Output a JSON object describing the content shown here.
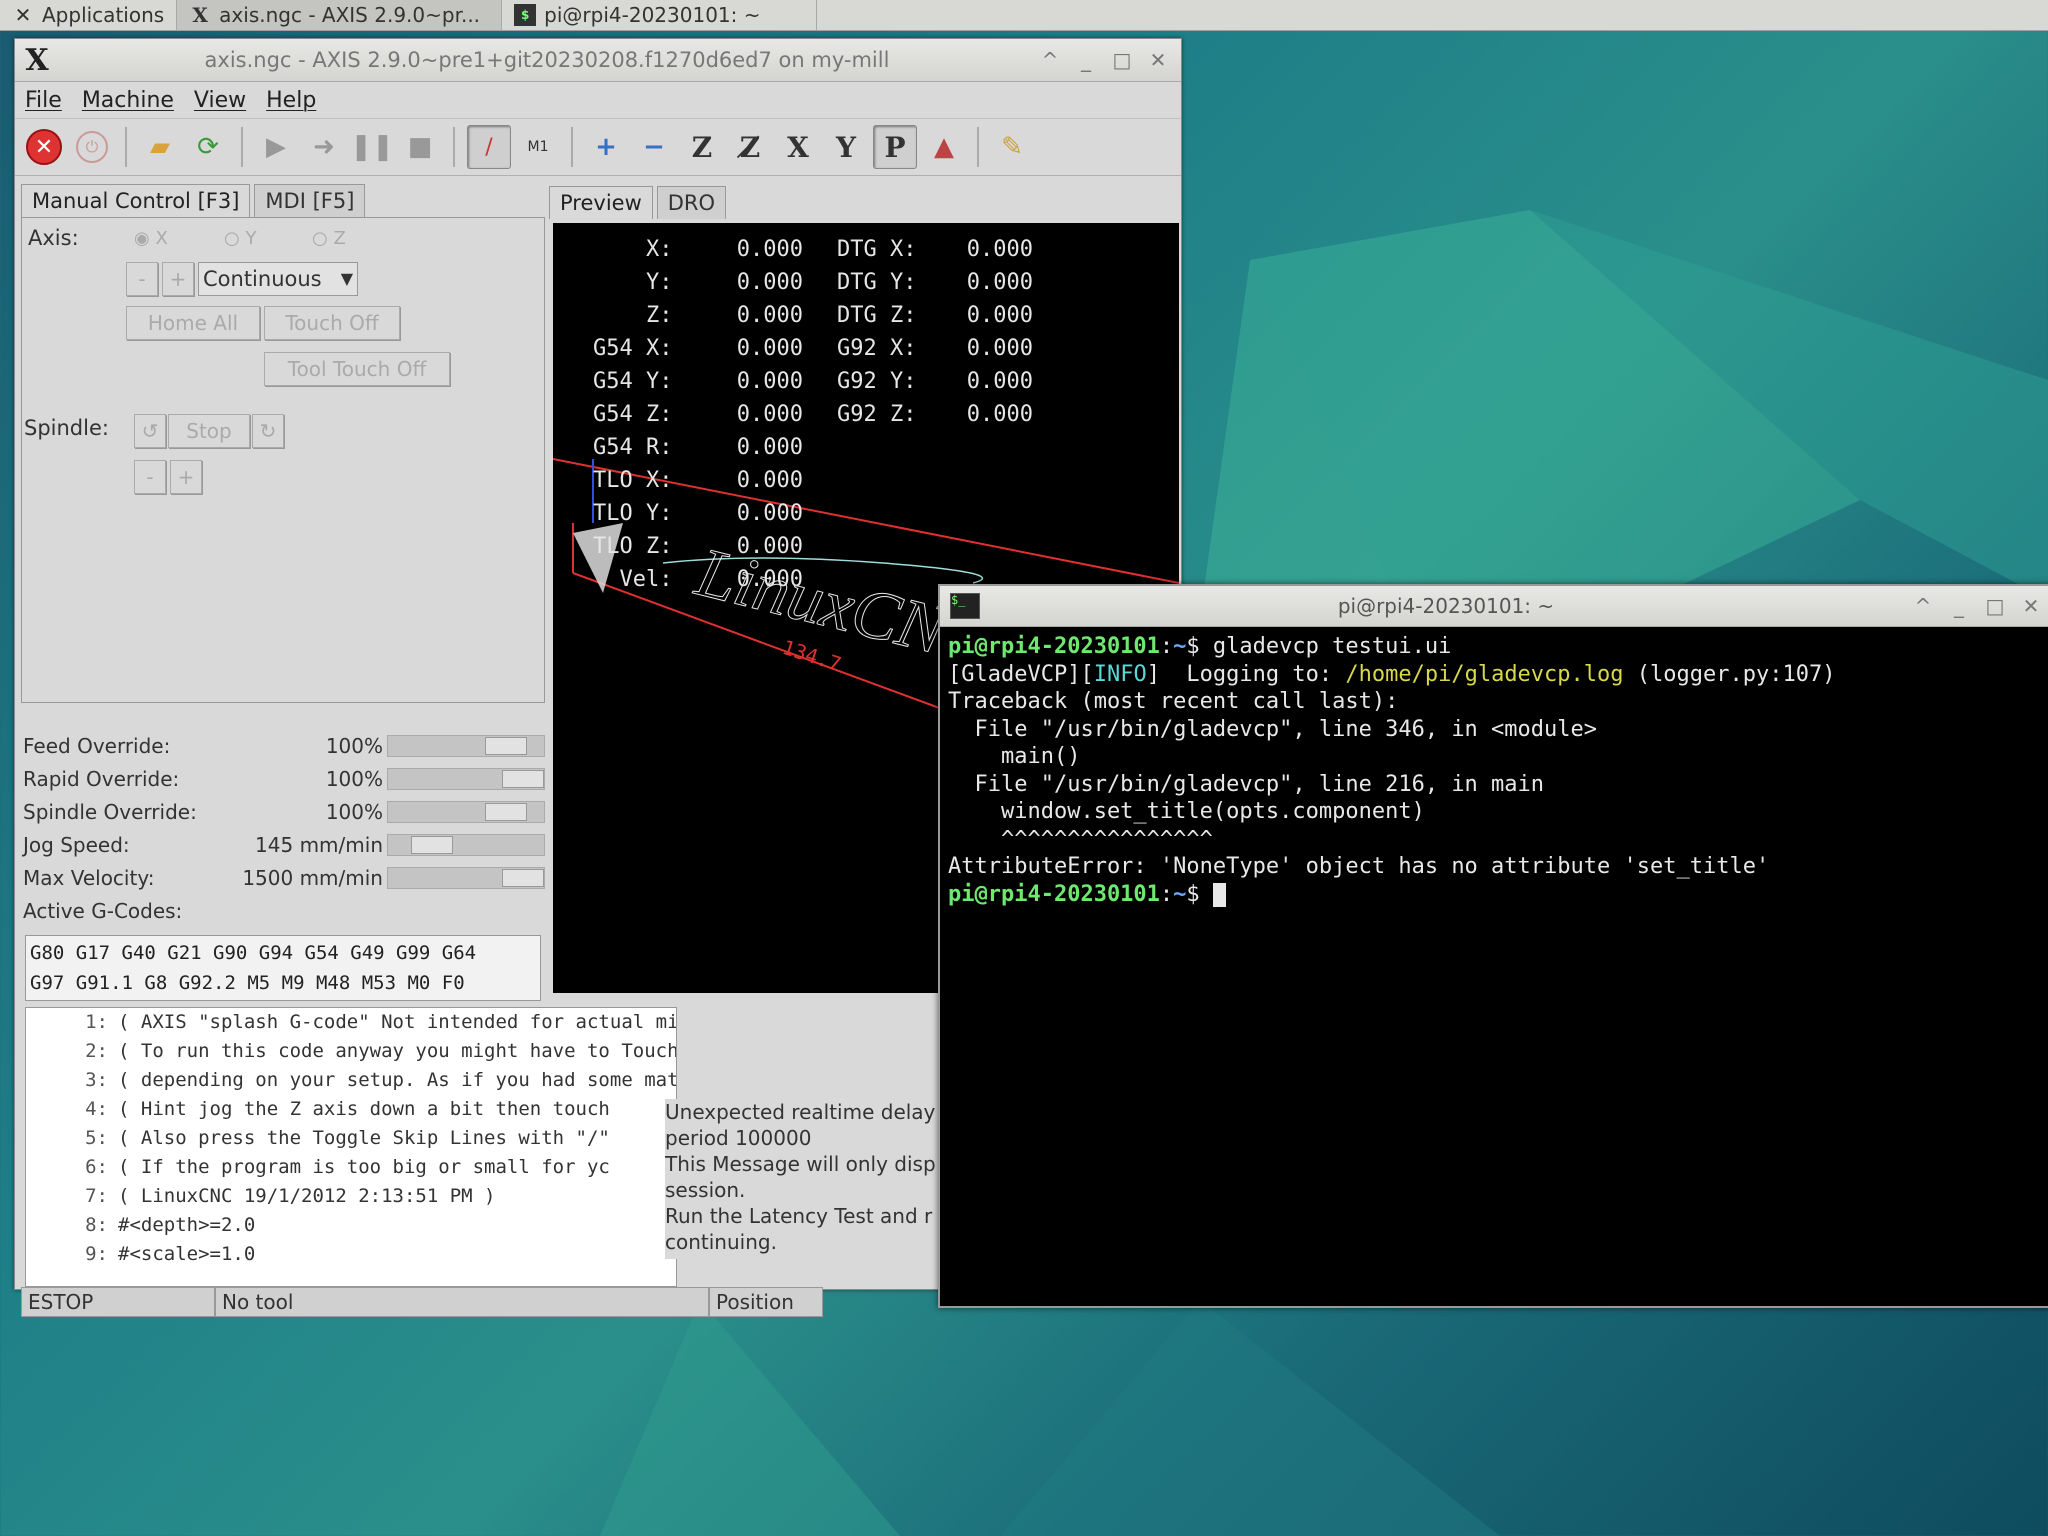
{
  "taskbar": {
    "apps_label": "Applications",
    "task1": "axis.ngc - AXIS 2.9.0~pr...",
    "task2": "pi@rpi4-20230101: ~"
  },
  "axis_window": {
    "title": "axis.ngc - AXIS 2.9.0~pre1+git20230208.f1270d6ed7 on my-mill",
    "menu": [
      "File",
      "Machine",
      "View",
      "Help"
    ],
    "tabs": {
      "manual": "Manual Control [F3]",
      "mdi": "MDI [F5]"
    },
    "axis_label": "Axis:",
    "axis_options": [
      "X",
      "Y",
      "Z"
    ],
    "jog_minus": "-",
    "jog_plus": "+",
    "jog_mode": "Continuous",
    "home_all": "Home All",
    "touch_off": "Touch Off",
    "tool_touch_off": "Tool Touch Off",
    "spindle_label": "Spindle:",
    "spindle_stop": "Stop",
    "sliders": [
      {
        "name": "Feed Override:",
        "value": "100%",
        "position": 0.85
      },
      {
        "name": "Rapid Override:",
        "value": "100%",
        "position": 1.0
      },
      {
        "name": "Spindle Override:",
        "value": "100%",
        "position": 0.85
      },
      {
        "name": "Jog Speed:",
        "value": "145 mm/min",
        "position": 0.2
      },
      {
        "name": "Max Velocity:",
        "value": "1500 mm/min",
        "position": 1.0
      }
    ],
    "active_gcodes_label": "Active G-Codes:",
    "active_gcodes": [
      "G80 G17 G40 G21 G90 G94 G54 G49 G99 G64",
      "G97 G91.1 G8 G92.2 M5 M9 M48 M53 M0 F0"
    ],
    "preview_tabs": {
      "preview": "Preview",
      "dro": "DRO"
    },
    "dro": [
      [
        "    X:",
        "0.000",
        "DTG X:",
        "0.000"
      ],
      [
        "    Y:",
        "0.000",
        "DTG Y:",
        "0.000"
      ],
      [
        "    Z:",
        "0.000",
        "DTG Z:",
        "0.000"
      ],
      [
        "G54 X:",
        "0.000",
        "G92 X:",
        "0.000"
      ],
      [
        "G54 Y:",
        "0.000",
        "G92 Y:",
        "0.000"
      ],
      [
        "G54 Z:",
        "0.000",
        "G92 Z:",
        "0.000"
      ],
      [
        "G54 R:",
        "0.000",
        "",
        ""
      ],
      [
        "TLO X:",
        "0.000",
        "",
        ""
      ],
      [
        "TLO Y:",
        "0.000",
        "",
        ""
      ],
      [
        "TLO Z:",
        "0.000",
        "",
        ""
      ],
      [
        "  Vel:",
        "0.000",
        "",
        ""
      ]
    ],
    "preview_dim": "134.7",
    "program": [
      {
        "n": "1:",
        "text": "( AXIS \"splash G-code\" Not intended for actual milling )"
      },
      {
        "n": "2:",
        "text": "( To run this code anyway you might have to Touch Off the Z axis)"
      },
      {
        "n": "3:",
        "text": "( depending on your setup. As if you had some material in your mi"
      },
      {
        "n": "4:",
        "text": "( Hint jog the Z axis down a bit then touch"
      },
      {
        "n": "5:",
        "text": "( Also press the Toggle Skip Lines with \"/\""
      },
      {
        "n": "6:",
        "text": "( If the program is too big or small for yc"
      },
      {
        "n": "7:",
        "text": "( LinuxCNC 19/1/2012 2:13:51 PM )"
      },
      {
        "n": "8:",
        "text": "#<depth>=2.0"
      },
      {
        "n": "9:",
        "text": "#<scale>=1.0"
      }
    ],
    "message": [
      "Unexpected realtime delay",
      "period 100000",
      "This Message will only disp",
      "session.",
      "Run the Latency Test and r",
      "continuing."
    ],
    "status": {
      "state": "ESTOP",
      "tool": "No tool",
      "position": "Position"
    }
  },
  "terminal": {
    "title": "pi@rpi4-20230101: ~",
    "prompt_user": "pi@rpi4-20230101",
    "prompt_sep": ":",
    "prompt_dir": "~",
    "prompt_end": "$ ",
    "command": "gladevcp testui.ui",
    "log_prefix": "[GladeVCP][",
    "log_level": "INFO",
    "log_mid": "]  Logging to: ",
    "log_path": "/home/pi/gladevcp.log",
    "log_suffix": " (logger.py:107)",
    "lines": [
      "Traceback (most recent call last):",
      "  File \"/usr/bin/gladevcp\", line 346, in <module>",
      "    main()",
      "  File \"/usr/bin/gladevcp\", line 216, in main",
      "    window.set_title(opts.component)",
      "    ^^^^^^^^^^^^^^^^",
      "AttributeError: 'NoneType' object has no attribute 'set_title'"
    ]
  }
}
